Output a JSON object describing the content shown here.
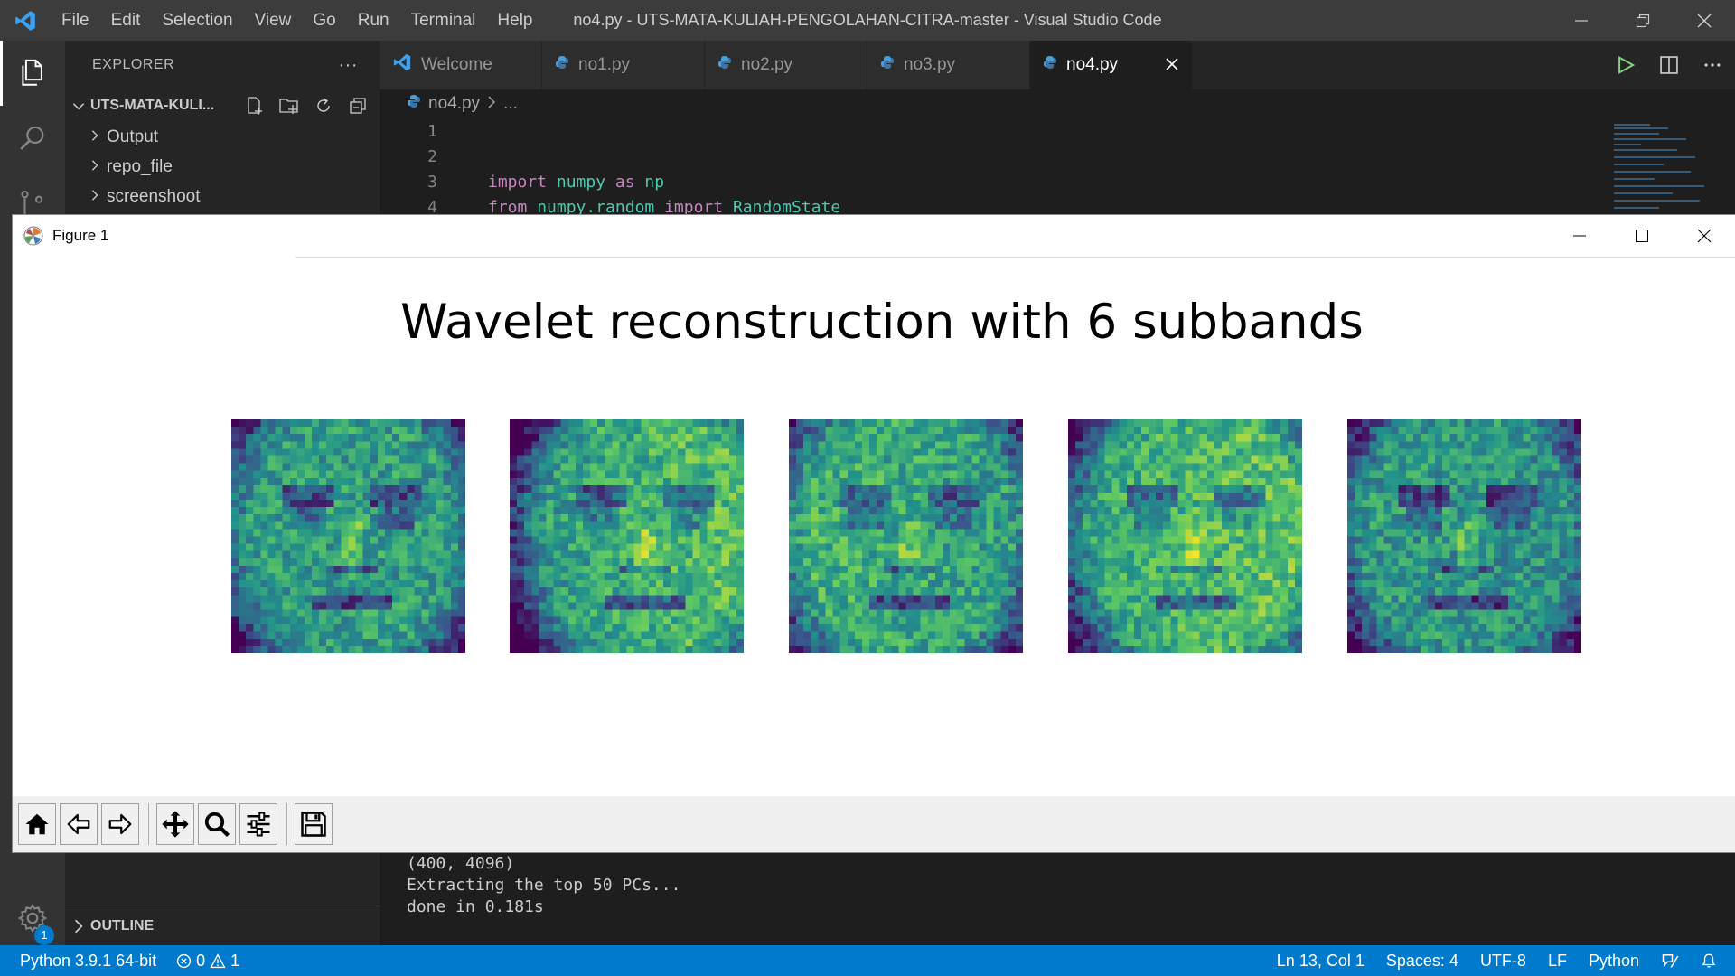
{
  "window": {
    "title": "no4.py - UTS-MATA-KULIAH-PENGOLAHAN-CITRA-master - Visual Studio Code",
    "menu": [
      "File",
      "Edit",
      "Selection",
      "View",
      "Go",
      "Run",
      "Terminal",
      "Help"
    ]
  },
  "explorer": {
    "header": "EXPLORER",
    "more": "···",
    "folder": "UTS-MATA-KULI...",
    "items": [
      "Output",
      "repo_file",
      "screenshoot"
    ],
    "outline": "OUTLINE"
  },
  "tabs": [
    {
      "label": "Welcome",
      "icon": "vscode-icon",
      "active": false
    },
    {
      "label": "no1.py",
      "icon": "python-icon",
      "active": false
    },
    {
      "label": "no2.py",
      "icon": "python-icon",
      "active": false
    },
    {
      "label": "no3.py",
      "icon": "python-icon",
      "active": false
    },
    {
      "label": "no4.py",
      "icon": "python-icon",
      "active": true
    }
  ],
  "breadcrumb": {
    "file": "no4.py",
    "rest": "..."
  },
  "code": {
    "line_numbers": [
      "1",
      "2",
      "3",
      "4"
    ],
    "line3": {
      "kw1": "import",
      "mod": " numpy",
      "kw2": " as",
      "alias": " np"
    },
    "line4": {
      "kw1": "from",
      "mod": " numpy.random",
      "kw2": " import",
      "cls": " RandomState"
    }
  },
  "figure": {
    "window_title": "Figure 1",
    "suptitle": "Wavelet reconstruction with 6 subbands",
    "colormap": "viridis",
    "image_count": 5
  },
  "terminal": {
    "lines": [
      "(400, 4096)",
      "Extracting the top 50 PCs...",
      "done in 0.181s"
    ]
  },
  "status": {
    "python": "Python 3.9.1 64-bit",
    "errors": "0",
    "warnings": "1",
    "position": "Ln 13, Col 1",
    "spaces": "Spaces: 4",
    "encoding": "UTF-8",
    "eol": "LF",
    "language": "Python"
  },
  "manage_badge": "1",
  "colors": {
    "accent": "#007acc",
    "titlebar": "#3c3c3c",
    "sidebar": "#252526",
    "editor": "#1e1e1e"
  }
}
